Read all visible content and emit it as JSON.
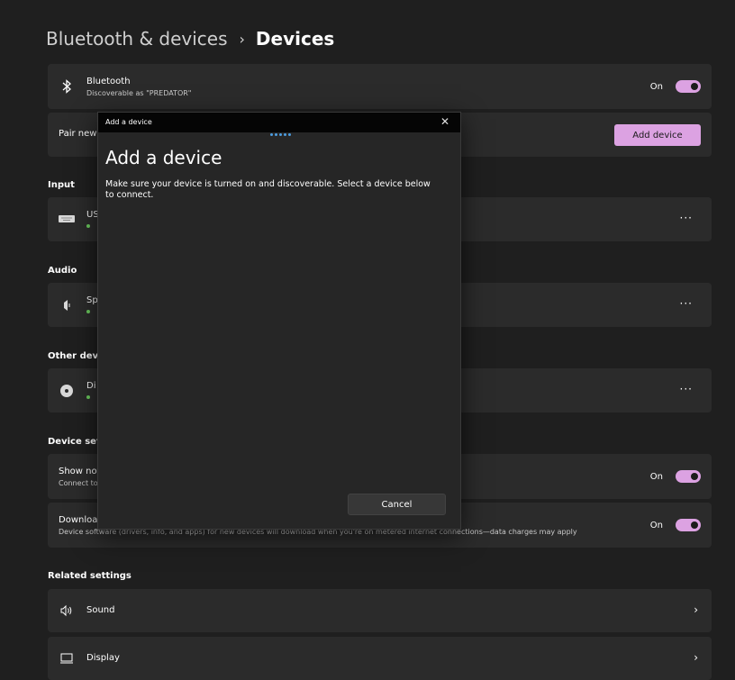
{
  "breadcrumb": {
    "parent": "Bluetooth & devices",
    "separator": "›",
    "current": "Devices"
  },
  "bluetooth": {
    "title": "Bluetooth",
    "subtitle": "Discoverable as \"PREDATOR\"",
    "state": "On",
    "on": true
  },
  "pair": {
    "label_visible": "Pair new d",
    "button": "Add device"
  },
  "sections": {
    "input": "Input",
    "audio": "Audio",
    "other": "Other devic",
    "device_settings": "Device setti",
    "related": "Related settings"
  },
  "input_device": {
    "name_visible": "US",
    "icon": "keyboard-icon",
    "more": "···"
  },
  "audio_device": {
    "name_visible": "Sp",
    "icon": "speaker-icon",
    "more": "···"
  },
  "other_device": {
    "name_visible": "Di",
    "icon": "disc-icon",
    "more": "···"
  },
  "notifications": {
    "title_visible": "Show not",
    "sub_visible": "Connect to",
    "state": "On",
    "on": true
  },
  "download": {
    "title_visible": "Downloa",
    "sub_visible": "Device software (drivers, info, and apps) for new devices will download when you're on metered internet connections—data charges may apply",
    "state": "On",
    "on": true
  },
  "related": [
    {
      "label": "Sound",
      "icon": "sound-icon"
    },
    {
      "label": "Display",
      "icon": "display-icon"
    }
  ],
  "dialog": {
    "window_title": "Add a device",
    "close": "✕",
    "heading": "Add a device",
    "description": "Make sure your device is turned on and discoverable. Select a device below to connect.",
    "cancel": "Cancel"
  },
  "colors": {
    "accent": "#dca2e2",
    "online": "#6ccb5f",
    "background": "#1f1f1f",
    "card": "#2b2b2b",
    "progress": "#4c9de0"
  }
}
